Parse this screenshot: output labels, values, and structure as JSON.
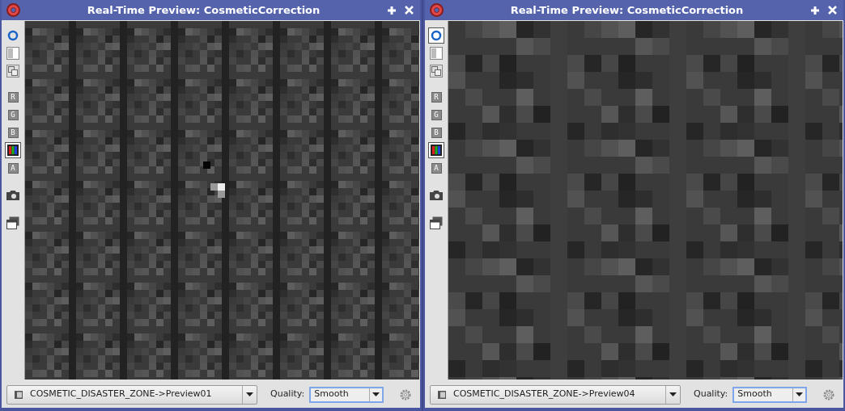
{
  "windows": [
    {
      "title": "Real-Time Preview: CosmeticCorrection",
      "tools": [
        {
          "kind": "circle",
          "selected": false
        },
        {
          "kind": "checker",
          "selected": false
        },
        {
          "kind": "squares",
          "selected": false
        },
        {
          "kind": "channel",
          "label": "R",
          "selected": false
        },
        {
          "kind": "channel",
          "label": "G",
          "selected": false
        },
        {
          "kind": "channel",
          "label": "B",
          "selected": false
        },
        {
          "kind": "rgb",
          "selected": true
        },
        {
          "kind": "channel",
          "label": "A",
          "selected": false
        },
        {
          "kind": "camera",
          "selected": false
        },
        {
          "kind": "windows",
          "selected": false
        }
      ],
      "view": "COSMETIC_DISASTER_ZONE->Preview01",
      "quality_label": "Quality:",
      "quality": "Smooth"
    },
    {
      "title": "Real-Time Preview: CosmeticCorrection",
      "tools": [
        {
          "kind": "circle",
          "selected": true
        },
        {
          "kind": "checker",
          "selected": false
        },
        {
          "kind": "squares",
          "selected": false
        },
        {
          "kind": "channel",
          "label": "R",
          "selected": false
        },
        {
          "kind": "channel",
          "label": "G",
          "selected": false
        },
        {
          "kind": "channel",
          "label": "B",
          "selected": false
        },
        {
          "kind": "rgb",
          "selected": true
        },
        {
          "kind": "channel",
          "label": "A",
          "selected": false
        },
        {
          "kind": "camera",
          "selected": false
        },
        {
          "kind": "windows",
          "selected": false
        }
      ],
      "view": "COSMETIC_DISASTER_ZONE->Preview04",
      "quality_label": "Quality:",
      "quality": "Smooth"
    }
  ]
}
